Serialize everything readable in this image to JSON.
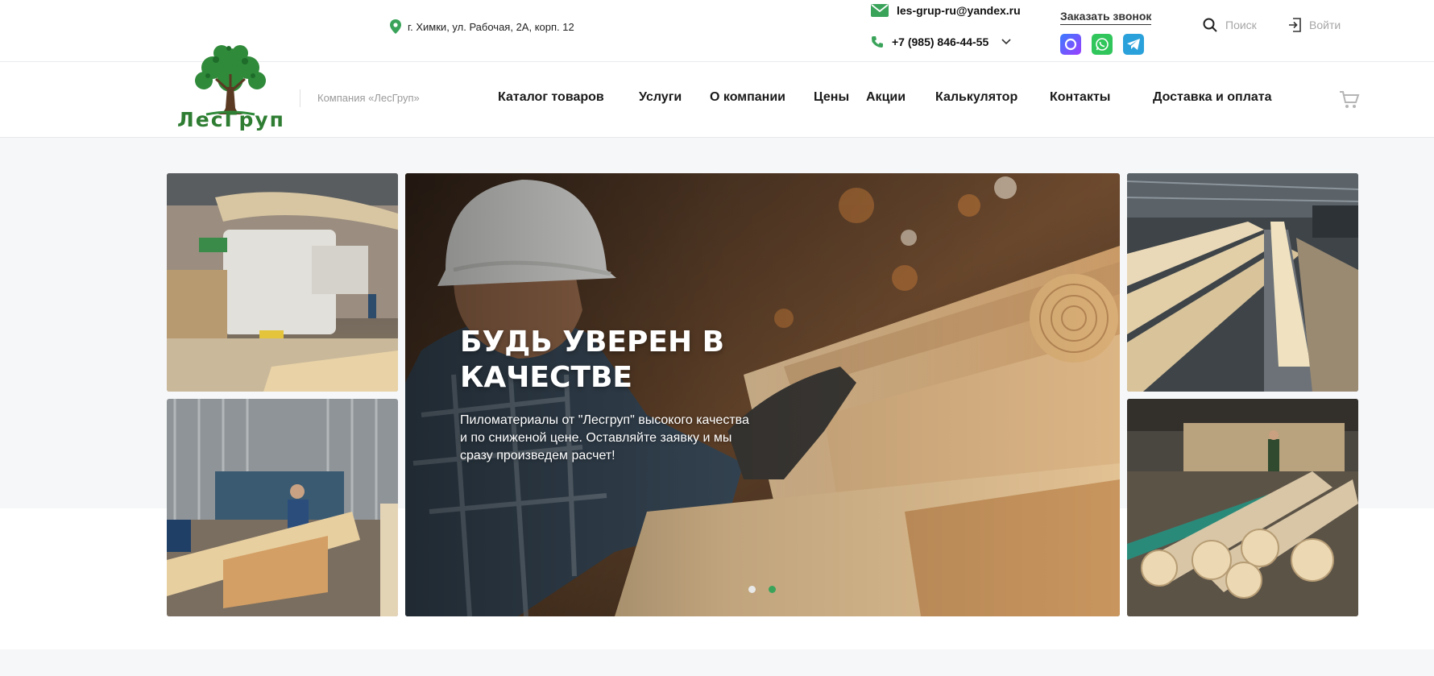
{
  "header": {
    "address": "г. Химки, ул. Рабочая, 2А, корп. 12",
    "email": "les-grup-ru@yandex.ru",
    "phone": "+7 (985) 846-44-55",
    "callback_label": "Заказать звонок",
    "search_label": "Поиск",
    "login_label": "Войти",
    "logo_text": "ЛесГруп",
    "company_name": "Компания «ЛесГруп»",
    "messengers": [
      "max-icon",
      "whatsapp-icon",
      "telegram-icon"
    ]
  },
  "nav": {
    "items": [
      "Каталог товаров",
      "Услуги",
      "О компании",
      "Цены",
      "Акции",
      "Калькулятор",
      "Контакты",
      "Доставка и оплата"
    ]
  },
  "hero": {
    "title": "БУДЬ УВЕРЕН В КАЧЕСТВЕ",
    "subtitle": "Пиломатериалы от \"Лесгруп\" высокого качества и по сниженой цене. Оставляйте заявку и мы сразу произведем расчет!",
    "slides_total": 2,
    "active_slide": 2
  },
  "colors": {
    "brand_green": "#2e7d32",
    "accent_green": "#3aa35a",
    "band_gray": "#f6f7f8"
  }
}
